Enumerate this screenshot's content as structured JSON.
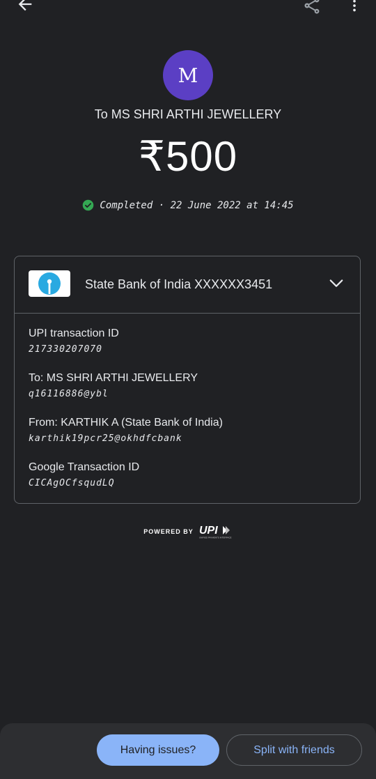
{
  "toolbar": {
    "back_icon": "back-arrow-icon",
    "share_icon": "share-icon",
    "more_icon": "more-vert-icon"
  },
  "payee": {
    "avatar_letter": "M",
    "avatar_color": "#5b3fc4",
    "title": "To MS SHRI ARTHI JEWELLERY"
  },
  "amount": "₹500",
  "status": {
    "icon": "check-circle-icon",
    "color": "#34a853",
    "text": "Completed · 22 June 2022 at 14:45"
  },
  "bank": {
    "logo_icon": "sbi-logo-icon",
    "name": "State Bank of India XXXXXX3451",
    "chevron_icon": "chevron-down-icon"
  },
  "details": [
    {
      "label": "UPI transaction ID",
      "value": "217330207070"
    },
    {
      "label": "To: MS SHRI ARTHI JEWELLERY",
      "value": "q16116886@ybl"
    },
    {
      "label": "From: KARTHIK  A (State Bank of India)",
      "value": "karthik19pcr25@okhdfcbank"
    },
    {
      "label": "Google Transaction ID",
      "value": "CICAgOCfsqudLQ"
    }
  ],
  "footer": {
    "powered_by": "POWERED BY",
    "upi_logo": "UPI",
    "upi_tagline": "UNIFIED PAYMENTS INTERFACE"
  },
  "actions": {
    "issues_label": "Having issues?",
    "split_label": "Split with friends",
    "accent": "#8ab4f8"
  }
}
